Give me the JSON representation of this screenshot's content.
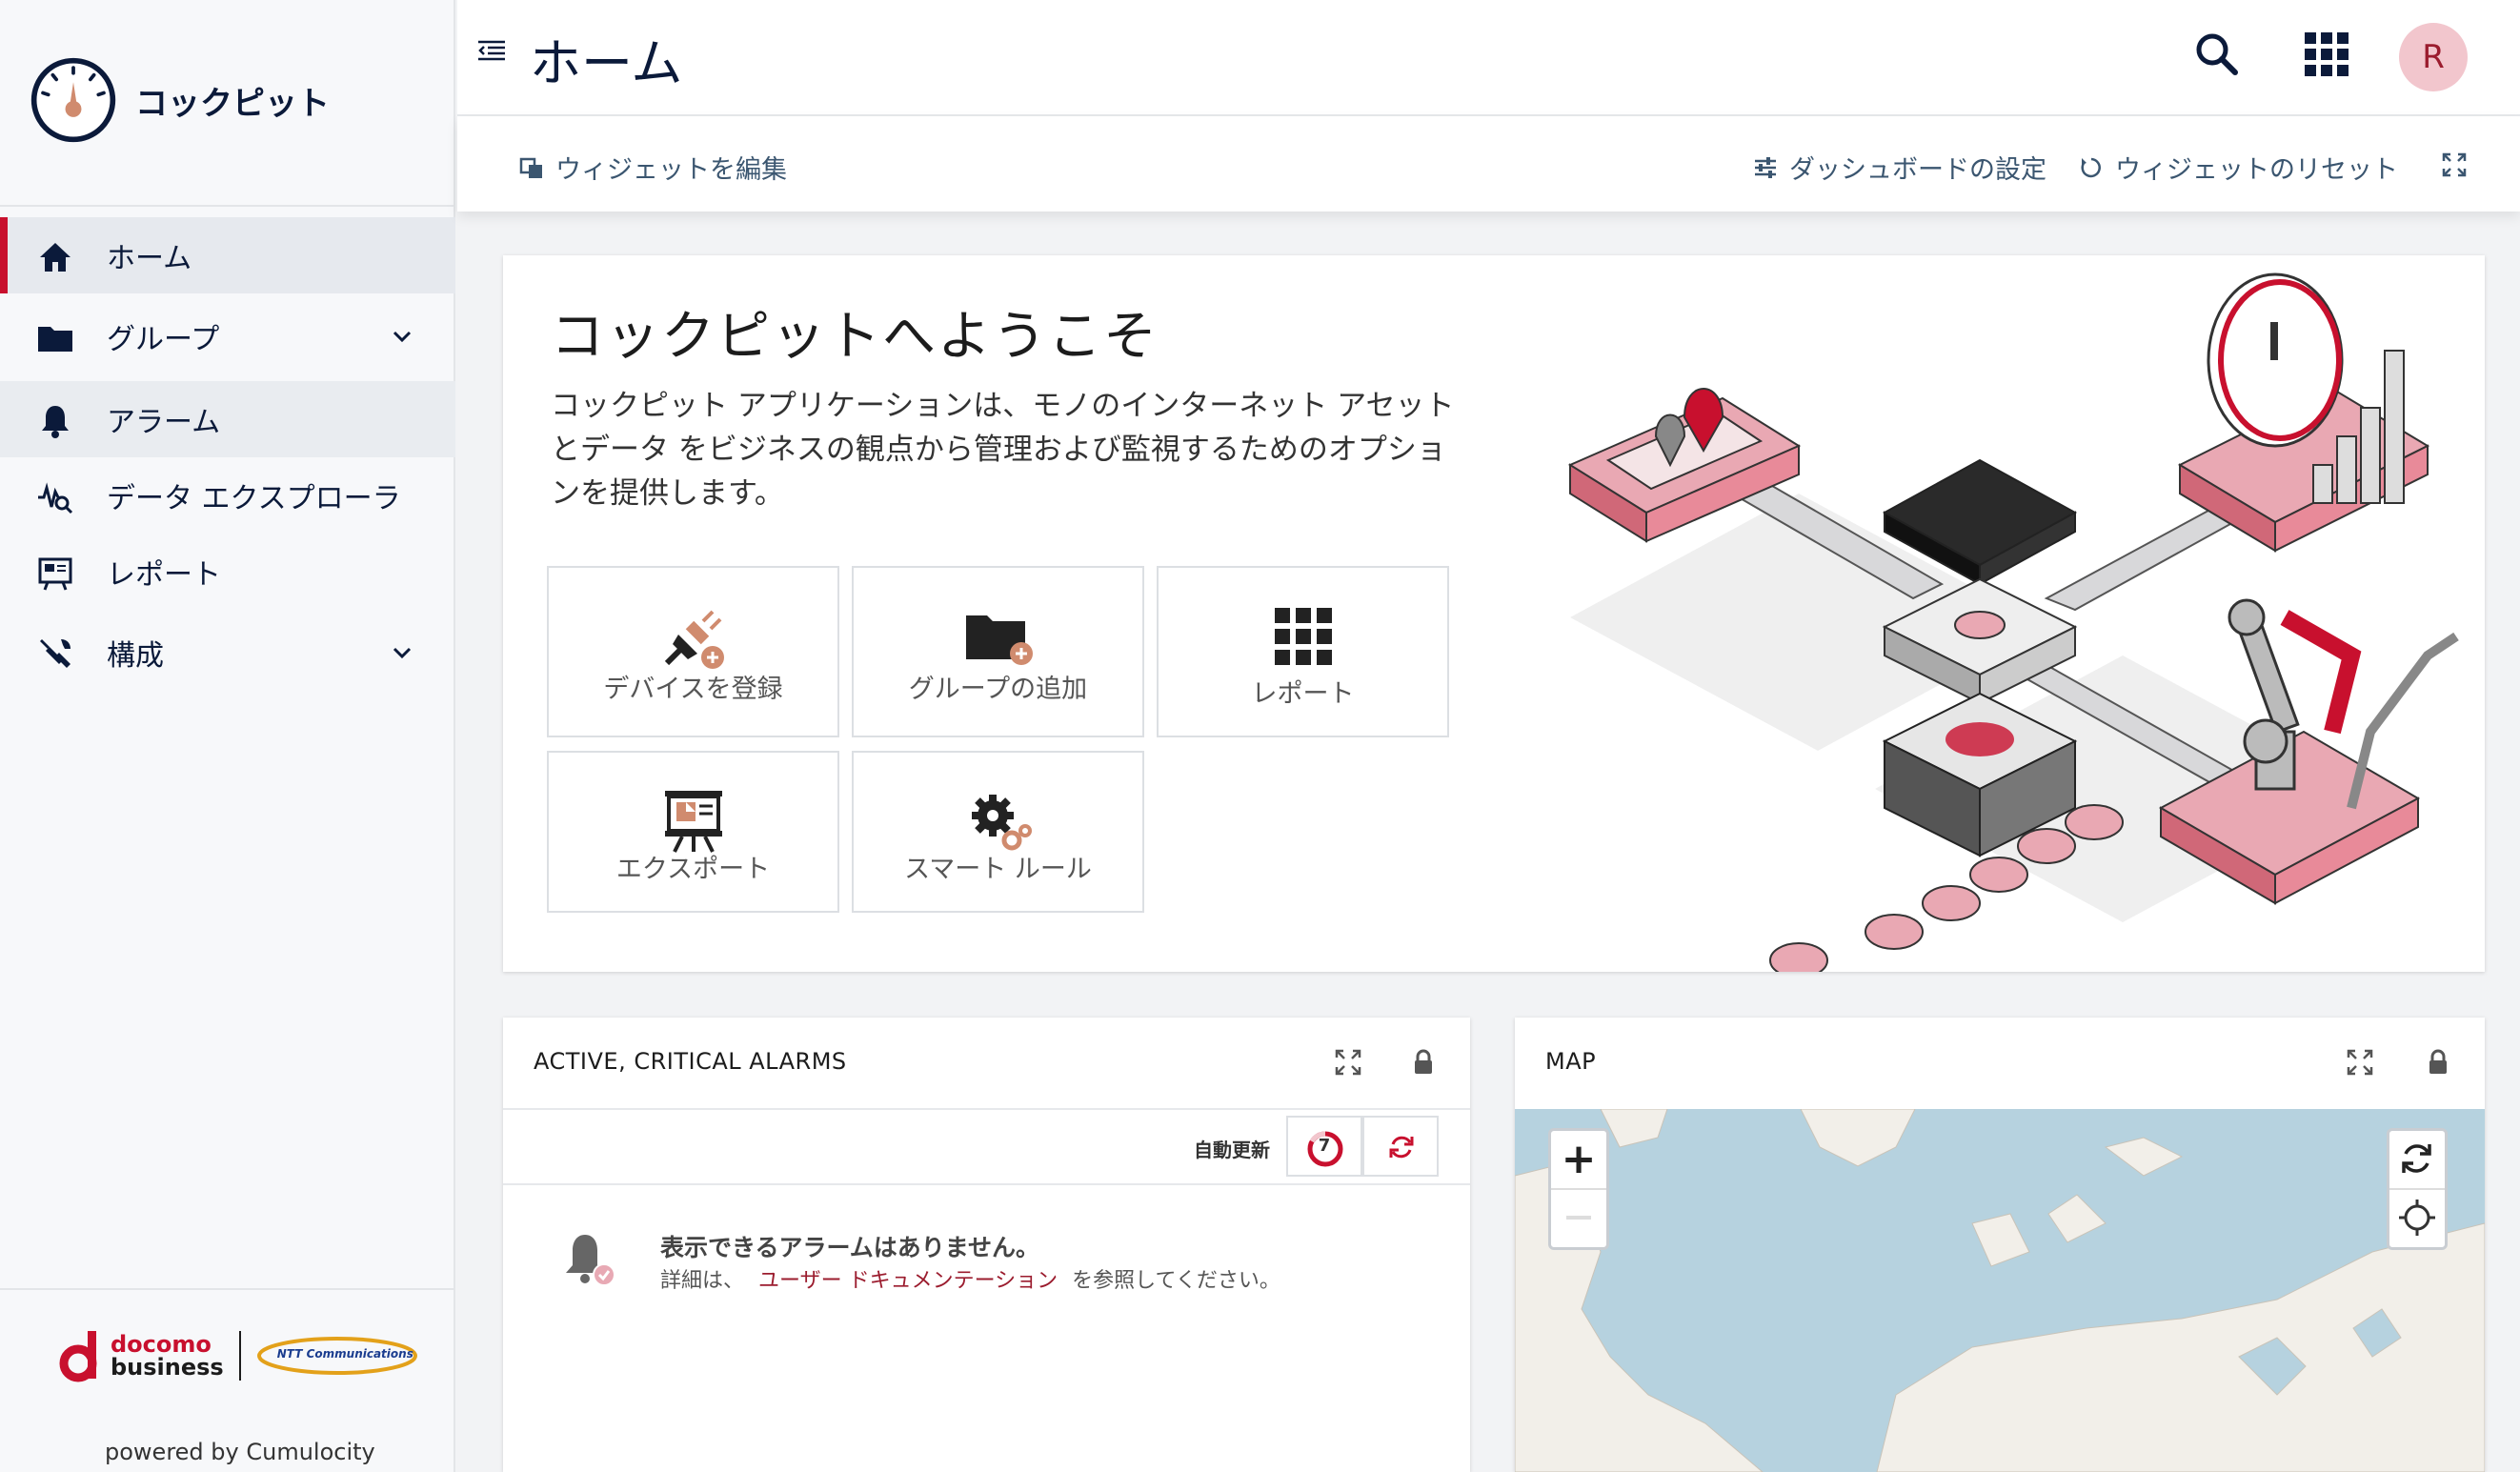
{
  "app": {
    "name": "コックピット"
  },
  "sidebar": {
    "items": [
      {
        "label": "ホーム",
        "icon": "home-icon"
      },
      {
        "label": "グループ",
        "icon": "folder-icon"
      },
      {
        "label": "アラーム",
        "icon": "bell-icon"
      },
      {
        "label": "データ エクスプローラ",
        "icon": "data-explorer-icon"
      },
      {
        "label": "レポート",
        "icon": "report-icon"
      },
      {
        "label": "構成",
        "icon": "tools-icon"
      }
    ],
    "brand_docomo": "docomo",
    "brand_business": "business",
    "brand_ntt": "NTT Communications",
    "powered_by": "powered by Cumulocity"
  },
  "header": {
    "title": "ホーム",
    "avatar": "R"
  },
  "toolbar": {
    "edit_widgets": "ウィジェットを編集",
    "dashboard_settings": "ダッシュボードの設定",
    "reset_widgets": "ウィジェットのリセット"
  },
  "welcome": {
    "title": "コックピットへようこそ",
    "description": "コックピット アプリケーションは、モノのインターネット アセットとデータ をビジネスの観点から管理および監視するためのオプションを提供します。",
    "quick_links": [
      {
        "label": "デバイスを登録"
      },
      {
        "label": "グループの追加"
      },
      {
        "label": "レポート"
      },
      {
        "label": "エクスポート"
      },
      {
        "label": "スマート ルール"
      }
    ]
  },
  "alarms_widget": {
    "title": "ACTIVE, CRITICAL ALARMS",
    "auto_refresh": "自動更新",
    "countdown": "7",
    "empty_title": "表示できるアラームはありません。",
    "empty_prefix": "詳細は、",
    "empty_link": "ユーザー ドキュメンテーション",
    "empty_suffix": "を参照してください。"
  },
  "map_widget": {
    "title": "MAP",
    "zoom_in": "+"
  },
  "colors": {
    "accent": "#c8102e",
    "navy": "#0b1a3a",
    "pink": "#e8a9b4"
  }
}
